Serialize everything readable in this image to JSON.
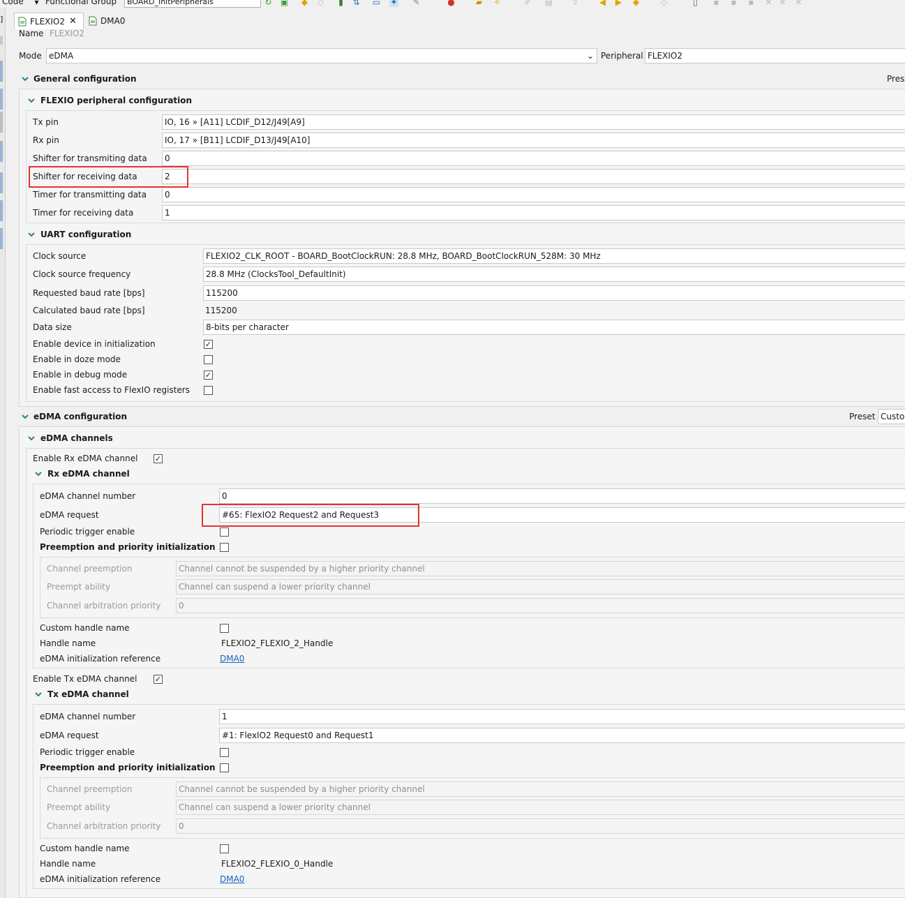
{
  "toolbar": {
    "code_label": "Code",
    "functional_group_label": "Functional Group",
    "functional_group_value": "BOARD_InitPeripherals"
  },
  "tabs": [
    {
      "label": "FLEXIO2",
      "active": true
    },
    {
      "label": "DMA0",
      "active": false
    }
  ],
  "name": {
    "label": "Name",
    "value": "FLEXIO2"
  },
  "mode": {
    "label": "Mode",
    "value": "eDMA",
    "peripheral_label": "Peripheral",
    "peripheral_value": "FLEXIO2"
  },
  "general": {
    "title": "General configuration",
    "preset_label": "Pres",
    "flexio": {
      "title": "FLEXIO peripheral configuration",
      "rows": [
        {
          "label": "Tx pin",
          "value": "IO, 16 » [A11] LCDIF_D12/J49[A9]"
        },
        {
          "label": "Rx pin",
          "value": "IO, 17 » [B11] LCDIF_D13/J49[A10]"
        },
        {
          "label": "Shifter for transmiting data",
          "value": "0"
        },
        {
          "label": "Shifter for receiving data",
          "value": "2"
        },
        {
          "label": "Timer for transmitting data",
          "value": "0"
        },
        {
          "label": "Timer for receiving data",
          "value": "1"
        }
      ]
    },
    "uart": {
      "title": "UART configuration",
      "clock_source": {
        "label": "Clock source",
        "value": "FLEXIO2_CLK_ROOT - BOARD_BootClockRUN: 28.8 MHz, BOARD_BootClockRUN_528M: 30 MHz"
      },
      "clock_freq": {
        "label": "Clock source frequency",
        "value": "28.8 MHz (ClocksTool_DefaultInit)"
      },
      "req_baud": {
        "label": "Requested baud rate [bps]",
        "value": "115200"
      },
      "calc_baud": {
        "label": "Calculated baud rate [bps]",
        "value": "115200"
      },
      "data_size": {
        "label": "Data size",
        "value": "8-bits per character"
      },
      "checks": [
        {
          "label": "Enable device in initialization",
          "checked": true
        },
        {
          "label": "Enable in doze mode",
          "checked": false
        },
        {
          "label": "Enable in debug mode",
          "checked": true
        },
        {
          "label": "Enable fast access to FlexIO registers",
          "checked": false
        }
      ]
    }
  },
  "edma": {
    "title": "eDMA configuration",
    "preset_label": "Preset",
    "preset_value": "Custor",
    "channels_title": "eDMA channels",
    "rx": {
      "enable_label": "Enable Rx eDMA channel",
      "enabled": true,
      "title": "Rx eDMA channel",
      "channel_number": {
        "label": "eDMA channel number",
        "value": "0"
      },
      "request": {
        "label": "eDMA request",
        "value": "#65: FlexIO2 Request2 and Request3"
      },
      "periodic": {
        "label": "Periodic trigger enable",
        "checked": false
      },
      "preemption": {
        "label": "Preemption and priority initialization",
        "checked": false
      },
      "sub": [
        {
          "label": "Channel preemption",
          "value": "Channel  cannot be suspended by a higher priority channel"
        },
        {
          "label": "Preempt ability",
          "value": "Channel  can suspend a lower priority channel"
        },
        {
          "label": "Channel arbitration priority",
          "value": "0"
        }
      ],
      "custom_handle": {
        "label": "Custom handle name",
        "checked": false
      },
      "handle_name": {
        "label": "Handle name",
        "value": "FLEXIO2_FLEXIO_2_Handle"
      },
      "init_ref": {
        "label": "eDMA initialization reference",
        "value": "DMA0"
      }
    },
    "tx": {
      "enable_label": "Enable Tx eDMA channel",
      "enabled": true,
      "title": "Tx eDMA channel",
      "channel_number": {
        "label": "eDMA channel number",
        "value": "1"
      },
      "request": {
        "label": "eDMA request",
        "value": "#1: FlexIO2 Request0 and Request1"
      },
      "periodic": {
        "label": "Periodic trigger enable",
        "checked": false
      },
      "preemption": {
        "label": "Preemption and priority initialization",
        "checked": false
      },
      "sub": [
        {
          "label": "Channel preemption",
          "value": "Channel  cannot be suspended by a higher priority channel"
        },
        {
          "label": "Preempt ability",
          "value": "Channel  can suspend a lower priority channel"
        },
        {
          "label": "Channel arbitration priority",
          "value": "0"
        }
      ],
      "custom_handle": {
        "label": "Custom handle name",
        "checked": false
      },
      "handle_name": {
        "label": "Handle name",
        "value": "FLEXIO2_FLEXIO_0_Handle"
      },
      "init_ref": {
        "label": "eDMA initialization reference",
        "value": "DMA0"
      }
    }
  },
  "colors": {
    "highlight": "#e0342c",
    "link": "#1565c0",
    "accent": "#2e7d8c"
  }
}
